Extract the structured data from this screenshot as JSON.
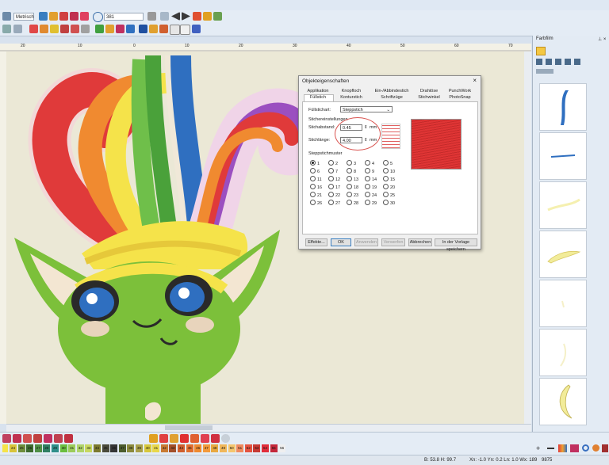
{
  "toolbar": {
    "units_combo": "Metrisch",
    "zoom_combo": "381"
  },
  "ruler": {
    "ticks": [
      "20",
      "10",
      "0",
      "10",
      "20",
      "30",
      "40",
      "50",
      "60",
      "70"
    ]
  },
  "panel": {
    "title": "Farbfilm",
    "pin": "⊥ ×"
  },
  "dialog": {
    "title": "Objekteigenschaften",
    "close": "×",
    "tabs_row1": [
      "Applikation",
      "Knopfloch",
      "Ein-/Abbindestich",
      "Drahtöse",
      "PunchWork"
    ],
    "tabs_row2": [
      "Füllstich",
      "Konturstich",
      "Schriftzüge",
      "Stichwinkel",
      "PhotoSnap"
    ],
    "fill_label": "Füllstichart:",
    "fill_value": "Steppstich",
    "settings_header": "Stichereinstellungen",
    "spacing_label": "Stichabstand:",
    "spacing_value": "0.45",
    "spacing_unit": "mm",
    "length_label": "Stichlänge:",
    "length_value": "4.00",
    "length_unit": "mm",
    "pattern_header": "Steppstichmuster",
    "patterns": [
      "1",
      "2",
      "3",
      "4",
      "5",
      "6",
      "7",
      "8",
      "9",
      "10",
      "11",
      "12",
      "13",
      "14",
      "15",
      "16",
      "17",
      "18",
      "19",
      "20",
      "21",
      "22",
      "23",
      "24",
      "25",
      "26",
      "27",
      "28",
      "29",
      "30"
    ],
    "selected_pattern": "1",
    "buttons": {
      "effects": "Effekte...",
      "ok": "OK",
      "apply": "Anwenden",
      "discard": "Verwerfen",
      "cancel": "Abbrechen",
      "save_template": "In der Vorlage speichern"
    }
  },
  "palette": {
    "numbers": [
      "24",
      "25",
      "26",
      "27",
      "28",
      "29",
      "30",
      "31",
      "32",
      "33",
      "34",
      "35",
      "36",
      "37",
      "38",
      "39",
      "40",
      "41",
      "42",
      "43",
      "44",
      "45",
      "46",
      "47",
      "48",
      "49",
      "50",
      "51",
      "52",
      "53",
      "54",
      "55",
      "56"
    ],
    "colors": [
      "#d9c43a",
      "#6f8e3c",
      "#3e6b2f",
      "#4f8f45",
      "#2f7f62",
      "#2f8f8a",
      "#6bbf3f",
      "#9ccc5a",
      "#b0d46a",
      "#c8d860",
      "#7c7a2e",
      "#4a4a3a",
      "#353535",
      "#4d5d2d",
      "#8c8b3d",
      "#a9a04a",
      "#d7c83b",
      "#e9d84a",
      "#c97a32",
      "#a34f2a",
      "#d05f2e",
      "#e26e2e",
      "#ef8a2f",
      "#f39a3b",
      "#e9a941",
      "#f0b75a",
      "#f5c66e",
      "#f08a5d",
      "#e5533f",
      "#c73a33",
      "#e12d3a",
      "#c4273a",
      "#efefef"
    ]
  },
  "status": {
    "coords": "B: 53.8 H: 99.7",
    "pos": "Xn: -1.0 Yn: 0.2 Ln: 1.0 Wx: 189",
    "count": "9875"
  },
  "colors": {
    "hair_red": "#e03a3a",
    "hair_blue": "#2f6fc0",
    "skin_green": "#7cc03a",
    "highlight_circle": "#d9534f"
  }
}
